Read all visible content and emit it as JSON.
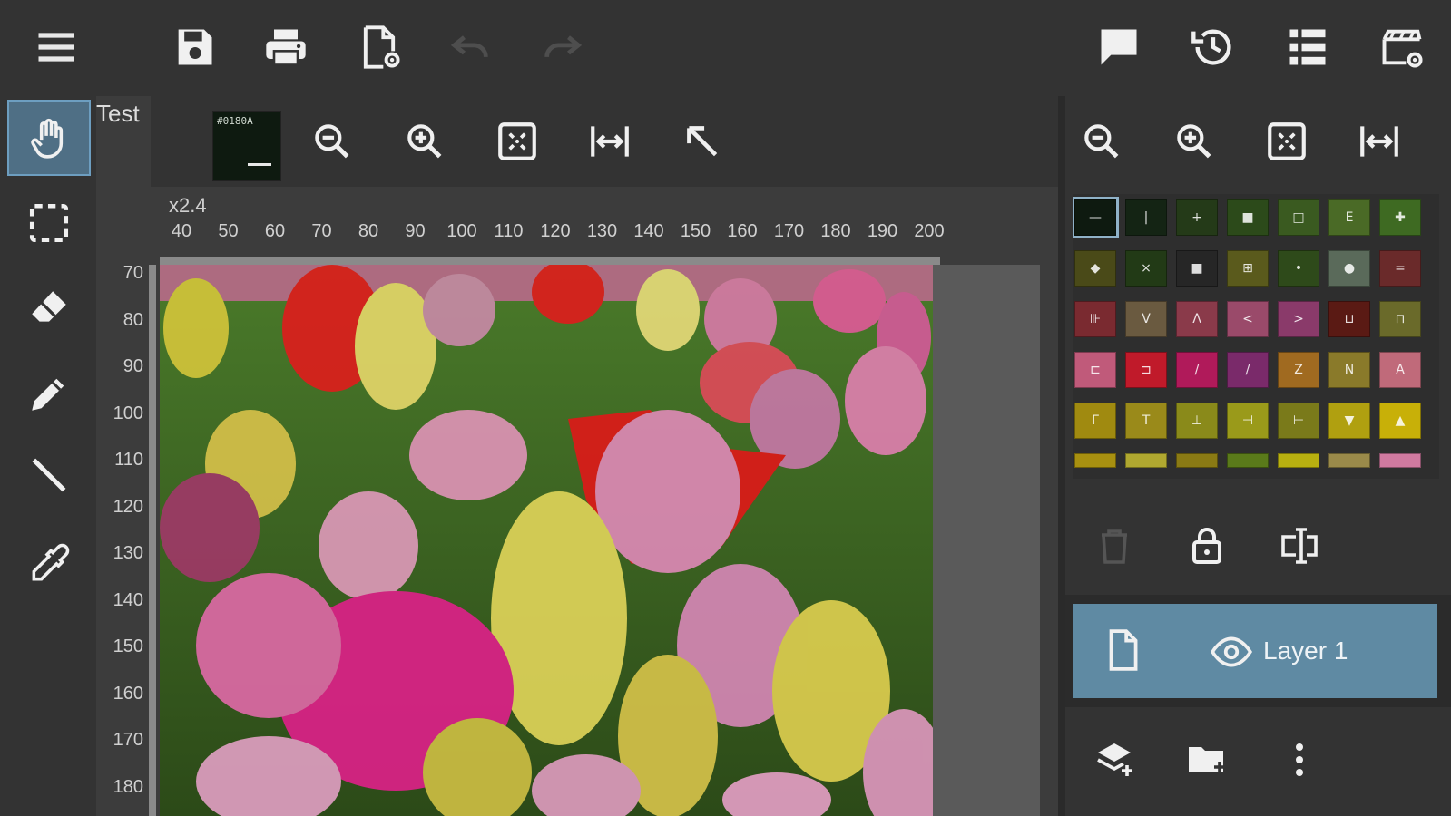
{
  "document": {
    "title": "Test"
  },
  "top_toolbar": {
    "icons": [
      "menu-icon",
      "save-icon",
      "print-icon",
      "document-settings-icon",
      "undo-icon",
      "redo-icon",
      "comment-icon",
      "history-icon",
      "list-view-icon",
      "clapperboard-settings-icon"
    ],
    "undo_enabled": false,
    "redo_enabled": false
  },
  "tools": [
    "hand-tool",
    "select-tool",
    "eraser-tool",
    "pencil-tool",
    "line-tool",
    "eyedropper-tool"
  ],
  "active_tool": "hand-tool",
  "current_color": {
    "hex": "#0E1A0A",
    "label": "#0180A"
  },
  "canvas": {
    "zoom_label": "x2.4",
    "h_ruler": [
      "40",
      "50",
      "60",
      "70",
      "80",
      "90",
      "100",
      "110",
      "120",
      "130",
      "140",
      "150",
      "160",
      "170",
      "180",
      "190",
      "200"
    ],
    "v_ruler": [
      "70",
      "80",
      "90",
      "100",
      "110",
      "120",
      "130",
      "140",
      "150",
      "160",
      "170",
      "180"
    ]
  },
  "canvas_toolbar": {
    "icons": [
      "zoom-out-icon",
      "zoom-in-icon",
      "fit-screen-icon",
      "fit-width-icon",
      "cursor-arrow-icon"
    ]
  },
  "right_toolbar": {
    "icons": [
      "zoom-out-icon",
      "zoom-in-icon",
      "fit-screen-icon",
      "fit-width-icon"
    ]
  },
  "palette": {
    "rows": [
      [
        {
          "c": "#0e1a10",
          "g": "—"
        },
        {
          "c": "#142414",
          "g": "|"
        },
        {
          "c": "#243a18",
          "g": "+"
        },
        {
          "c": "#2c4a1a",
          "g": "■"
        },
        {
          "c": "#3a5a20",
          "g": "□"
        },
        {
          "c": "#4a6a26",
          "g": "E"
        },
        {
          "c": "#3e6a22",
          "g": "✚"
        }
      ],
      [
        {
          "c": "#4a4a18",
          "g": "◆"
        },
        {
          "c": "#223a16",
          "g": "×"
        },
        {
          "c": "#262626",
          "g": "■"
        },
        {
          "c": "#5a5a1c",
          "g": "⊞"
        },
        {
          "c": "#2e4a1a",
          "g": "•"
        },
        {
          "c": "#5a6a5a",
          "g": "●"
        },
        {
          "c": "#6a2a2a",
          "g": "="
        }
      ],
      [
        {
          "c": "#7a2a30",
          "g": "⊪"
        },
        {
          "c": "#6a5a40",
          "g": "V"
        },
        {
          "c": "#8a3a4a",
          "g": "Λ"
        },
        {
          "c": "#9a4a6a",
          "g": "<"
        },
        {
          "c": "#8a3a6a",
          "g": ">"
        },
        {
          "c": "#5a1a14",
          "g": "⊔"
        },
        {
          "c": "#6a6a2a",
          "g": "⊓"
        }
      ],
      [
        {
          "c": "#c05a7a",
          "g": "⊏"
        },
        {
          "c": "#c01a2a",
          "g": "⊐"
        },
        {
          "c": "#b01a5a",
          "g": "/"
        },
        {
          "c": "#7a2a6a",
          "g": "∕"
        },
        {
          "c": "#a06a20",
          "g": "Z"
        },
        {
          "c": "#8a7a2a",
          "g": "N"
        },
        {
          "c": "#c06a7a",
          "g": "A"
        }
      ],
      [
        {
          "c": "#a08a10",
          "g": "Γ"
        },
        {
          "c": "#9a8a1a",
          "g": "T"
        },
        {
          "c": "#8a8a1a",
          "g": "⊥"
        },
        {
          "c": "#9a9a1a",
          "g": "⊣"
        },
        {
          "c": "#7a7a1a",
          "g": "⊢"
        },
        {
          "c": "#b0a010",
          "g": "▼"
        },
        {
          "c": "#c8b008",
          "g": "▲"
        }
      ],
      [
        {
          "c": "#a89010",
          "g": ""
        },
        {
          "c": "#b0a830",
          "g": ""
        },
        {
          "c": "#8a7a14",
          "g": ""
        },
        {
          "c": "#5a7a1a",
          "g": ""
        },
        {
          "c": "#b8b010",
          "g": ""
        },
        {
          "c": "#9a8a4a",
          "g": ""
        },
        {
          "c": "#d07aa0",
          "g": ""
        }
      ]
    ]
  },
  "layers": {
    "actions": [
      "trash-icon",
      "lock-icon",
      "rename-icon"
    ],
    "items": [
      {
        "name": "Layer 1",
        "visible": true,
        "selected": true
      }
    ],
    "bottom_actions": [
      "add-layer-icon",
      "add-folder-icon",
      "more-vertical-icon"
    ]
  }
}
